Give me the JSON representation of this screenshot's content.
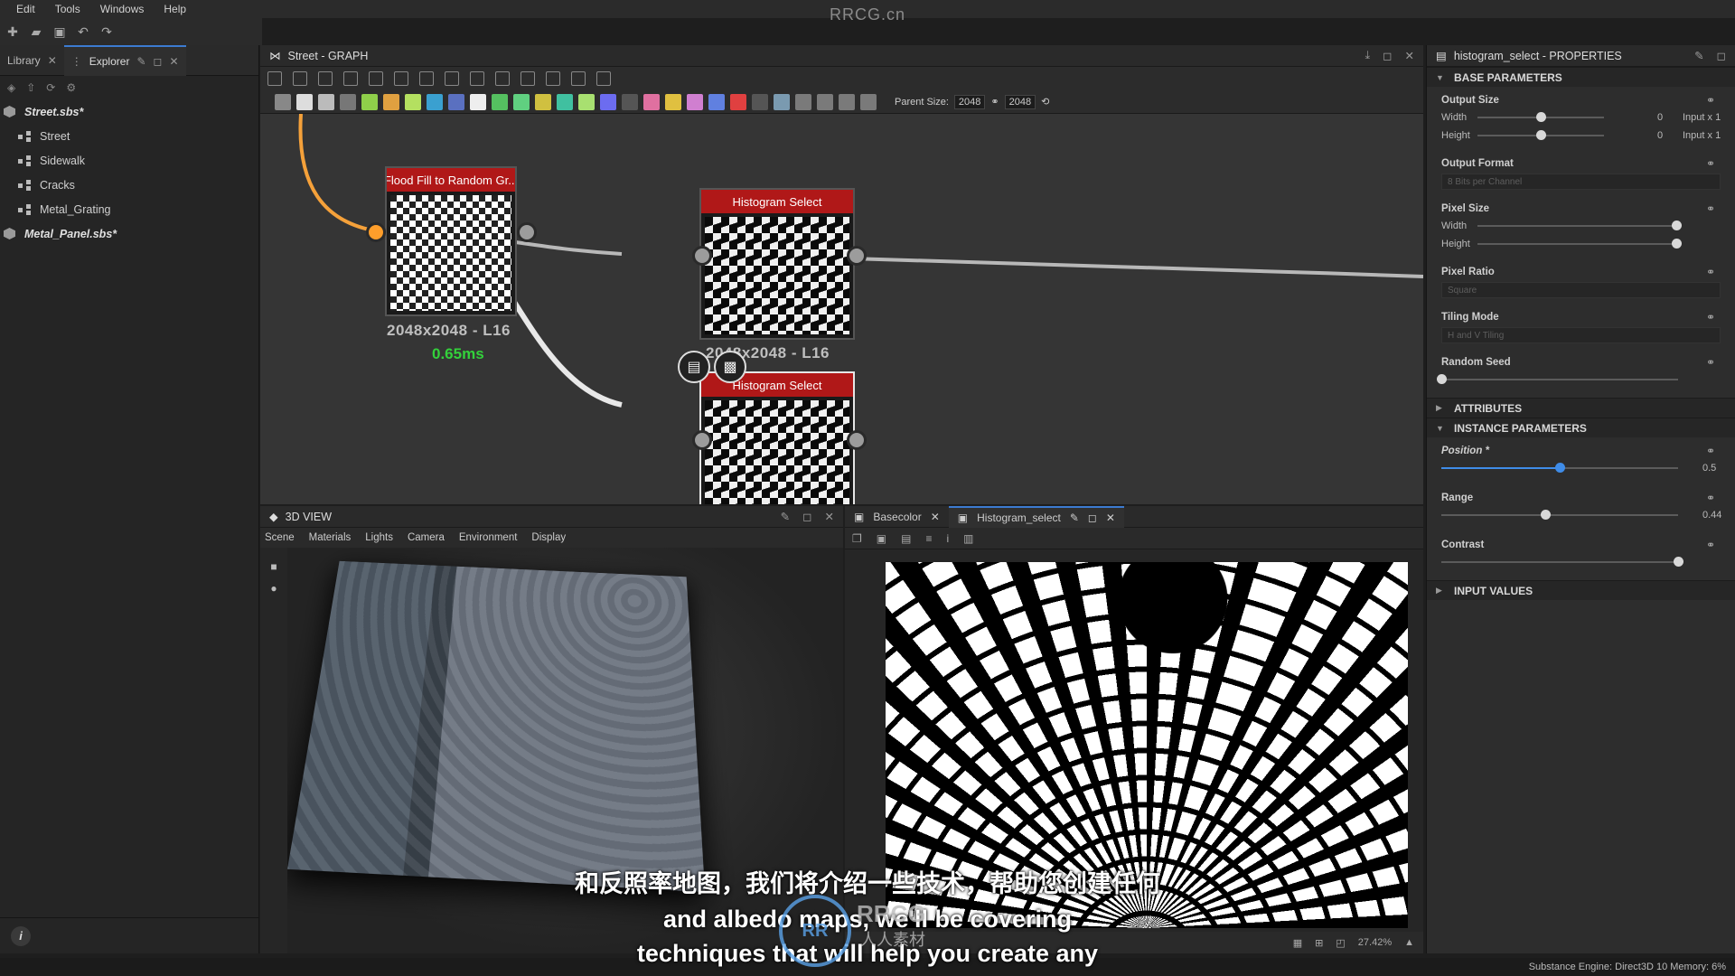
{
  "app_title": "RRCG.cn",
  "menu": [
    "Edit",
    "Tools",
    "Windows",
    "Help"
  ],
  "left_panel": {
    "tabs": [
      {
        "label": "Library"
      },
      {
        "label": "Explorer"
      }
    ],
    "tree": [
      {
        "label": "Street.sbs*",
        "kind": "package"
      },
      {
        "label": "Street",
        "kind": "graph"
      },
      {
        "label": "Sidewalk",
        "kind": "graph"
      },
      {
        "label": "Cracks",
        "kind": "graph"
      },
      {
        "label": "Metal_Grating",
        "kind": "graph"
      },
      {
        "label": "Metal_Panel.sbs*",
        "kind": "package"
      }
    ]
  },
  "graph_panel": {
    "title": "Street - GRAPH",
    "parent_size_label": "Parent Size:",
    "parent_size_value": "2048",
    "size_value": "2048",
    "nodes": [
      {
        "title": "Flood Fill to Random Gr...",
        "caption": "2048x2048 - L16",
        "time": "0.65ms"
      },
      {
        "title": "Histogram Select",
        "caption": "2048x2048 - L16"
      },
      {
        "title": "Histogram Select"
      }
    ]
  },
  "view3d": {
    "title": "3D VIEW",
    "menu": [
      "Scene",
      "Materials",
      "Lights",
      "Camera",
      "Environment",
      "Display"
    ]
  },
  "view2d": {
    "tabs": [
      {
        "label": "Basecolor"
      },
      {
        "label": "Histogram_select"
      }
    ],
    "zoom": "27.42%"
  },
  "properties": {
    "title": "histogram_select - PROPERTIES",
    "sections": {
      "base": "BASE PARAMETERS",
      "attributes": "ATTRIBUTES",
      "instance": "INSTANCE PARAMETERS",
      "input": "INPUT VALUES"
    },
    "output_size": {
      "label": "Output Size",
      "width_label": "Width",
      "height_label": "Height",
      "width_value": "0",
      "height_value": "0",
      "width_mode": "Input x 1",
      "height_mode": "Input x 1"
    },
    "output_format": {
      "label": "Output Format",
      "value": "8 Bits per Channel"
    },
    "pixel_size": {
      "label": "Pixel Size",
      "width_label": "Width",
      "height_label": "Height"
    },
    "pixel_ratio": {
      "label": "Pixel Ratio",
      "value": "Square"
    },
    "tiling_mode": {
      "label": "Tiling Mode",
      "value": "H and V Tiling"
    },
    "random_seed": {
      "label": "Random Seed"
    },
    "position": {
      "label": "Position *",
      "value": "0.5",
      "fraction": 0.5
    },
    "range": {
      "label": "Range",
      "value": "0.44",
      "fraction": 0.44
    },
    "contrast": {
      "label": "Contrast",
      "fraction": 1.0
    }
  },
  "status_bar": "Substance Engine: Direct3D 10  Memory: 6%",
  "subtitles": {
    "cn": "和反照率地图，我们将介绍一些技术，帮助您创建任何",
    "en1": "and albedo maps, we'll be covering",
    "en2": "techniques that will help you create any"
  },
  "watermark": {
    "logo": "RR",
    "text": "RRCG",
    "sub": "人人素材"
  },
  "colors": {
    "accent": "#3c7bd1",
    "node_header": "#b01818",
    "timing": "#33d13b",
    "port_active": "#ff9e2b"
  }
}
